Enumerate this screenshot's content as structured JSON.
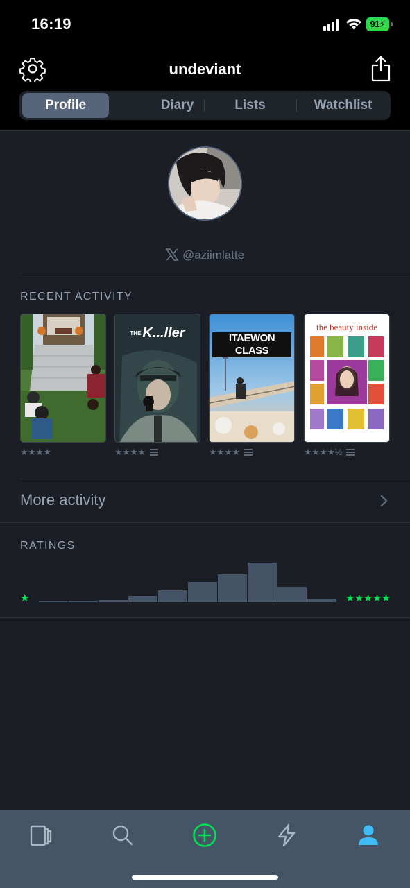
{
  "status_bar": {
    "time": "16:19",
    "battery": "91"
  },
  "header": {
    "username": "undeviant"
  },
  "tabs": [
    {
      "label": "Profile",
      "active": true
    },
    {
      "label": "Diary",
      "active": false
    },
    {
      "label": "Lists",
      "active": false
    },
    {
      "label": "Watchlist",
      "active": false
    }
  ],
  "profile": {
    "twitter_handle": "@aziimlatte"
  },
  "recent_activity": {
    "title": "RECENT ACTIVITY",
    "items": [
      {
        "poster_text": "",
        "rating": "★★★★",
        "has_review": false
      },
      {
        "poster_text": "THE KILLER",
        "poster_title_prefix": "THE",
        "poster_title_main": "K...ller",
        "rating": "★★★★",
        "has_review": true
      },
      {
        "poster_text": "ITAEWON CLASS",
        "rating": "★★★★",
        "has_review": true
      },
      {
        "poster_text": "the beauty inside",
        "rating": "★★★★½",
        "has_review": true
      }
    ]
  },
  "more_activity": {
    "label": "More activity"
  },
  "ratings": {
    "title": "RATINGS",
    "min_label": "★",
    "max_label": "★★★★★",
    "distribution": [
      0.02,
      0.02,
      0.05,
      0.16,
      0.3,
      0.5,
      0.71,
      1.0,
      0.38,
      0.07
    ]
  },
  "colors": {
    "accent_green": "#00e054",
    "background": "#1b1f25",
    "tabbar": "#445566",
    "active_tab": "#56657a"
  },
  "bottom_tabs": [
    {
      "icon": "films-icon"
    },
    {
      "icon": "search-icon"
    },
    {
      "icon": "add-log-icon"
    },
    {
      "icon": "activity-icon"
    },
    {
      "icon": "profile-icon",
      "active": true
    }
  ]
}
